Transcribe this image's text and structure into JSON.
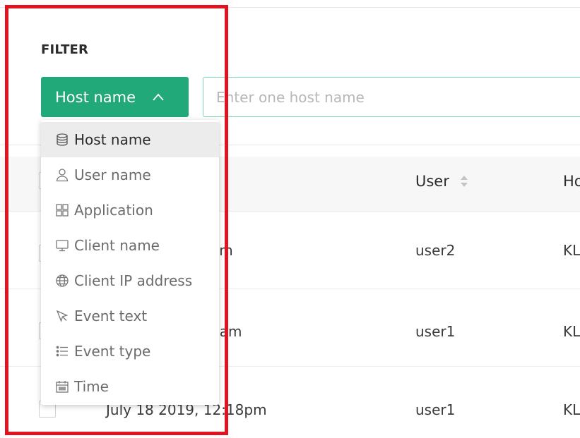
{
  "filter": {
    "title": "FILTER",
    "type_button_label": "Host name",
    "input_placeholder": "Enter one host name",
    "options": [
      {
        "label": "Host name",
        "icon": "database-icon",
        "selected": true
      },
      {
        "label": "User name",
        "icon": "user-icon",
        "selected": false
      },
      {
        "label": "Application",
        "icon": "application-grid-icon",
        "selected": false
      },
      {
        "label": "Client name",
        "icon": "monitor-icon",
        "selected": false
      },
      {
        "label": "Client IP address",
        "icon": "globe-icon",
        "selected": false
      },
      {
        "label": "Event text",
        "icon": "cursor-icon",
        "selected": false
      },
      {
        "label": "Event type",
        "icon": "list-icon",
        "selected": false
      },
      {
        "label": "Time",
        "icon": "calendar-icon",
        "selected": false
      }
    ]
  },
  "table": {
    "columns": {
      "user": "User",
      "host": "Ho"
    },
    "rows": [
      {
        "time": "am",
        "user": "user2",
        "host": "KL"
      },
      {
        "time": "3am",
        "user": "user1",
        "host": "KL"
      },
      {
        "time": "July 18 2019, 12:18pm",
        "user": "user1",
        "host": "KL"
      }
    ]
  },
  "colors": {
    "accent": "#21a97a",
    "input_border": "#7fd3b5",
    "highlight": "#e0141e"
  }
}
